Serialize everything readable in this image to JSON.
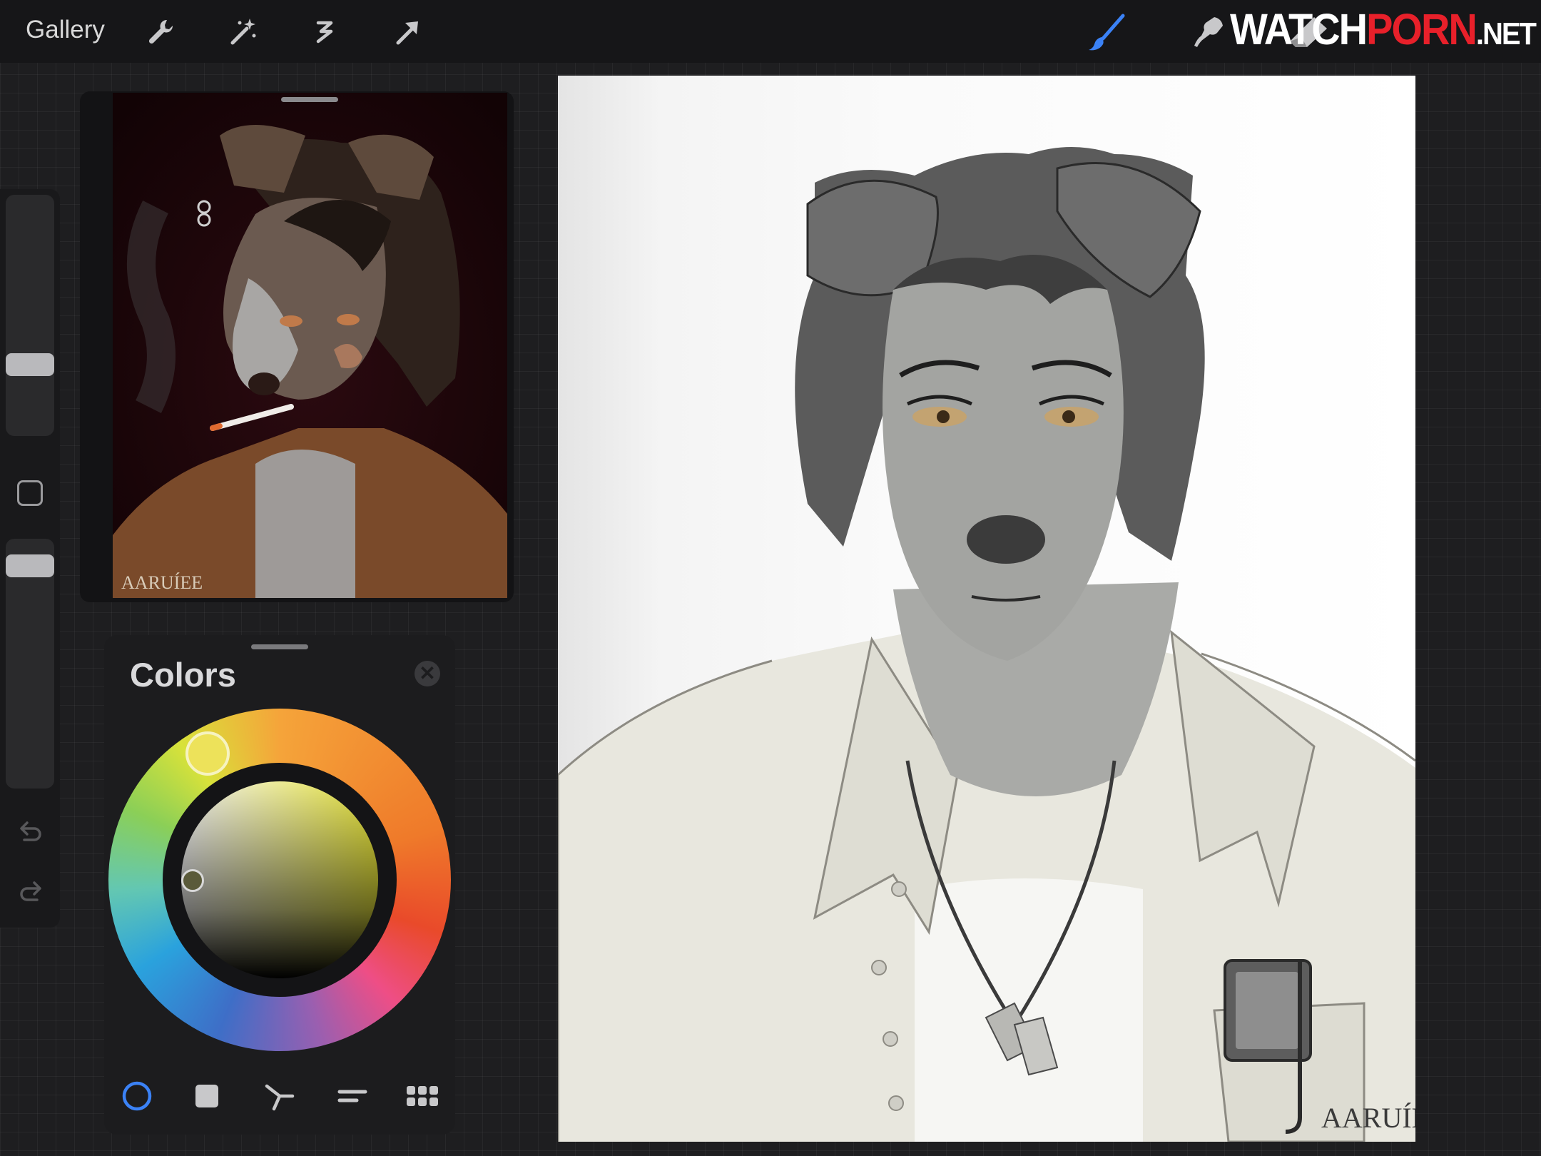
{
  "topbar": {
    "gallery_label": "Gallery",
    "left_tools": [
      "wrench-icon",
      "magic-wand-icon",
      "selection-icon",
      "transform-arrow-icon"
    ],
    "right_tools": [
      "brush-icon",
      "smudge-icon",
      "eraser-icon"
    ],
    "accent_color": "#3b82f6"
  },
  "watermark": {
    "part1": "WATCH",
    "part2": "PORN",
    "part3": ".NET"
  },
  "colors_panel": {
    "title": "Colors",
    "selected_tab": "disc",
    "tabs": [
      "disc",
      "classic",
      "harmony",
      "value",
      "palettes"
    ],
    "current_color": "#ede25a"
  },
  "reference": {
    "signature": "AARUÍEE"
  },
  "canvas": {
    "signature": "AARUÍEE"
  }
}
